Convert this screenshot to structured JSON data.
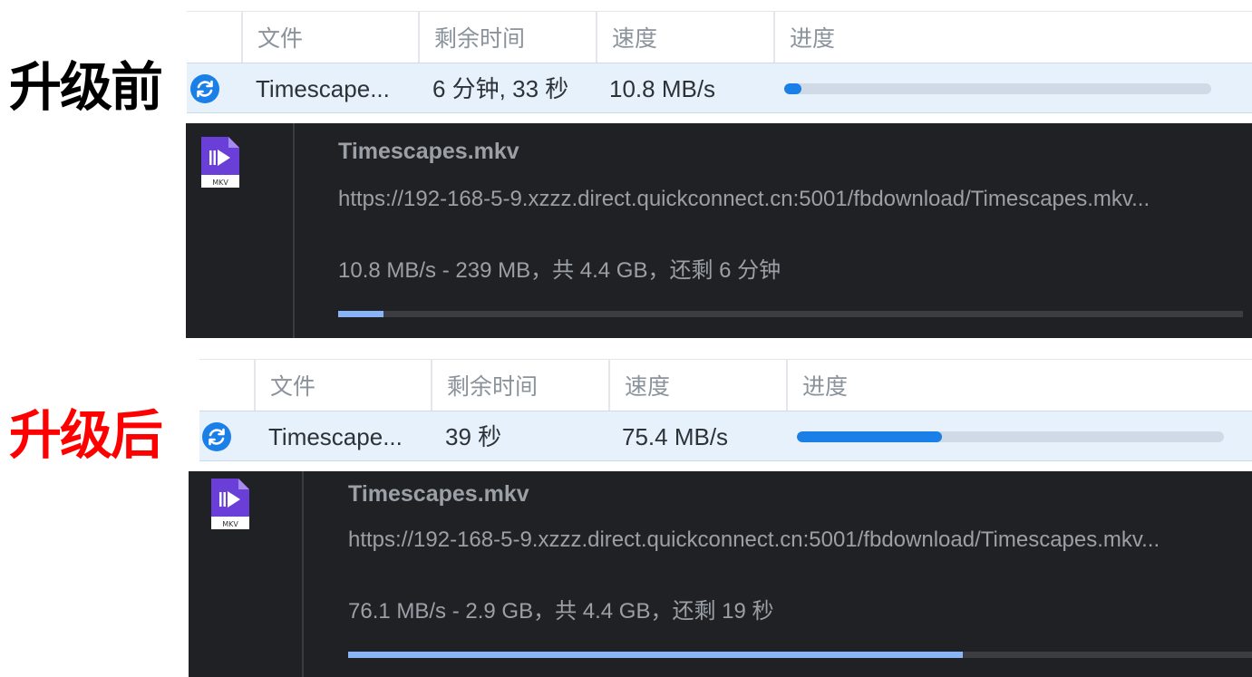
{
  "columns": [
    "文件",
    "剩余时间",
    "速度",
    "进度"
  ],
  "before": {
    "label": "升级前",
    "label_color": "#000000",
    "row": {
      "icon": "sync-icon",
      "file": "Timescape...",
      "remaining": "6 分钟, 33 秒",
      "speed": "10.8 MB/s",
      "progress_fraction": 0.04
    },
    "download": {
      "icon": "mkv-file-icon",
      "icon_label": "MKV",
      "name": "Timescapes.mkv",
      "url": "https://192-168-5-9.xzzz.direct.quickconnect.cn:5001/fbdownload/Timescapes.mkv...",
      "status": "10.8 MB/s - 239 MB，共 4.4 GB，还剩 6 分钟",
      "progress_fraction": 0.05
    }
  },
  "after": {
    "label": "升级后",
    "label_color": "#ff0000",
    "row": {
      "icon": "sync-icon",
      "file": "Timescape...",
      "remaining": "39 秒",
      "speed": "75.4 MB/s",
      "progress_fraction": 0.34
    },
    "download": {
      "icon": "mkv-file-icon",
      "icon_label": "MKV",
      "name": "Timescapes.mkv",
      "url": "https://192-168-5-9.xzzz.direct.quickconnect.cn:5001/fbdownload/Timescapes.mkv...",
      "status": "76.1 MB/s - 2.9 GB，共 4.4 GB，还剩 19 秒",
      "progress_fraction": 0.68
    }
  },
  "colors": {
    "accent": "#1a7fe6",
    "row_highlight": "#e6f1fc",
    "dark_bg": "#202124",
    "dark_bar_fill": "#8ab4f8",
    "mkv_purple": "#6a3fd8"
  }
}
